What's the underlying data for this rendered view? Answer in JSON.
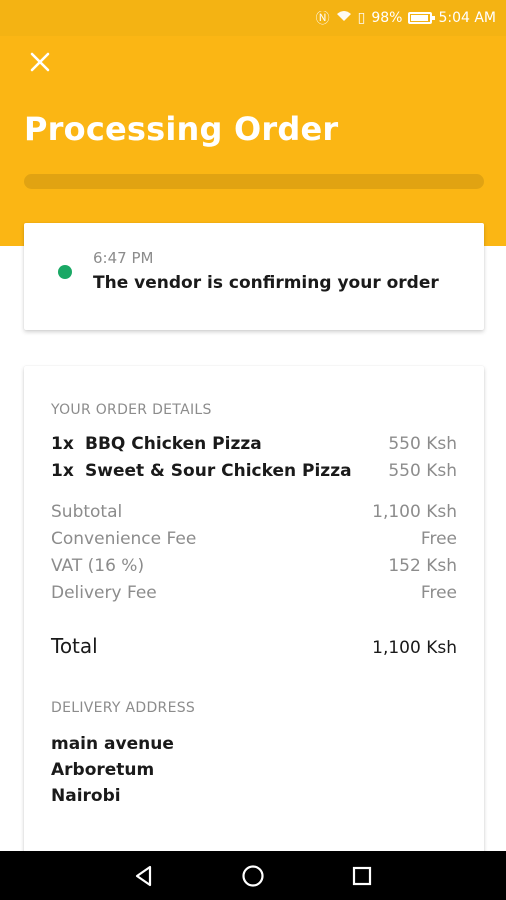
{
  "status_bar": {
    "battery": "98%",
    "time": "5:04 AM"
  },
  "header": {
    "title": "Processing Order",
    "progress": 0.0
  },
  "status_card": {
    "time": "6:47 PM",
    "message": "The vendor is confirming your order",
    "dot_color": "#1aa865"
  },
  "order": {
    "details_label": "YOUR ORDER DETAILS",
    "items": [
      {
        "qty": "1x",
        "name": "BBQ Chicken Pizza",
        "amount": "550 Ksh"
      },
      {
        "qty": "1x",
        "name": "Sweet & Sour Chicken Pizza",
        "amount": "550 Ksh"
      }
    ],
    "fees": [
      {
        "label": "Subtotal",
        "amount": "1,100 Ksh"
      },
      {
        "label": "Convenience Fee",
        "amount": "Free"
      },
      {
        "label": "VAT (16 %)",
        "amount": "152 Ksh"
      },
      {
        "label": "Delivery Fee",
        "amount": "Free"
      }
    ],
    "total_label": "Total",
    "total_amount": "1,100 Ksh",
    "address_label": "DELIVERY ADDRESS",
    "address_lines": [
      "main avenue",
      "Arboretum",
      "Nairobi"
    ]
  },
  "colors": {
    "accent": "#fbb614",
    "status_green": "#1aa865"
  },
  "icons": {
    "close": "close-icon",
    "back": "back-triangle-icon",
    "home": "home-circle-icon",
    "recents": "recents-square-icon"
  }
}
